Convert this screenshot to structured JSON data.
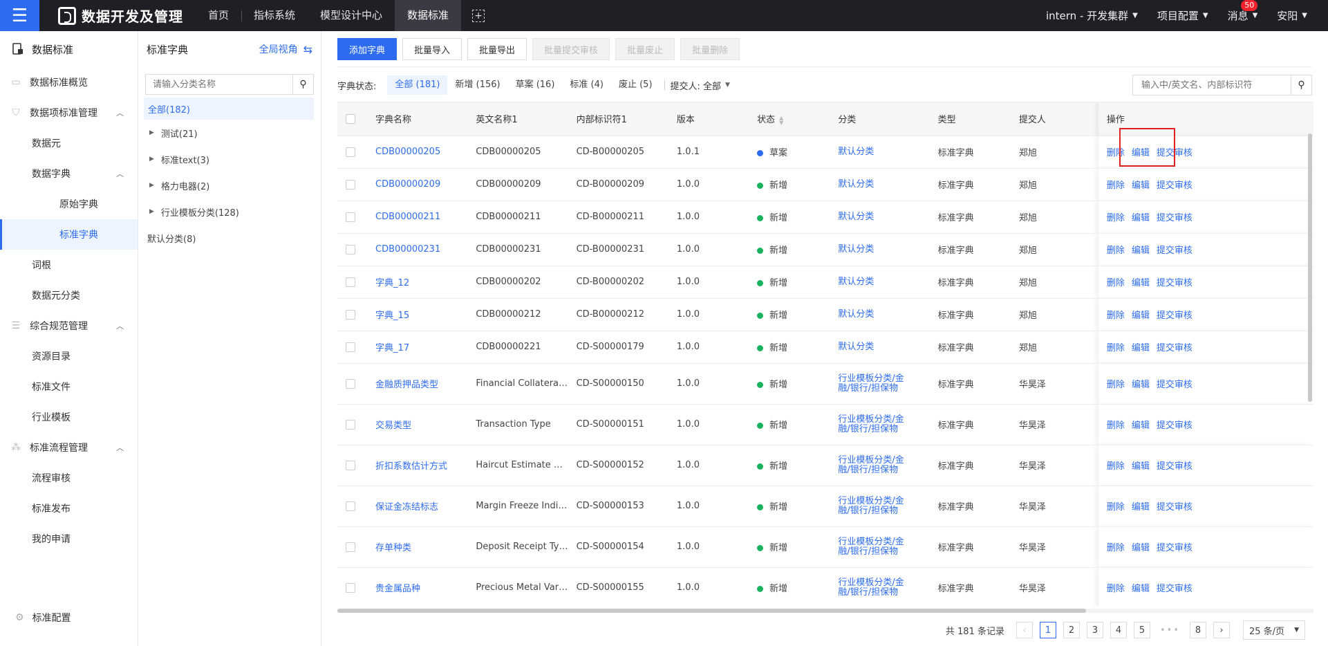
{
  "topbar": {
    "app_title": "数据开发及管理",
    "nav": [
      "首页",
      "指标系统",
      "模型设计中心",
      "数据标准"
    ],
    "cluster": "intern - 开发集群",
    "project": "项目配置",
    "messages": "消息",
    "message_count": "50",
    "user": "安阳"
  },
  "sidebar": {
    "title": "数据标准",
    "items": [
      {
        "label": "数据标准概览"
      },
      {
        "label": "数据项标准管理"
      },
      {
        "label": "数据元"
      },
      {
        "label": "数据字典"
      },
      {
        "label": "原始字典"
      },
      {
        "label": "标准字典"
      },
      {
        "label": "词根"
      },
      {
        "label": "数据元分类"
      },
      {
        "label": "综合规范管理"
      },
      {
        "label": "资源目录"
      },
      {
        "label": "标准文件"
      },
      {
        "label": "行业模板"
      },
      {
        "label": "标准流程管理"
      },
      {
        "label": "流程审核"
      },
      {
        "label": "标准发布"
      },
      {
        "label": "我的申请"
      }
    ],
    "config": "标准配置"
  },
  "tree": {
    "title": "标准字典",
    "view_link": "全局视角",
    "search_placeholder": "请输入分类名称",
    "nodes": [
      "全部(182)",
      "测试(21)",
      "标准text(3)",
      "格力电器(2)",
      "行业模板分类(128)",
      "默认分类(8)"
    ]
  },
  "toolbar": {
    "add": "添加字典",
    "import": "批量导入",
    "export": "批量导出",
    "submit": "批量提交审核",
    "deprecate": "批量废止",
    "delete": "批量删除"
  },
  "filter": {
    "label": "字典状态:",
    "tabs": [
      "全部 (181)",
      "新增 (156)",
      "草案 (16)",
      "标准 (4)",
      "废止 (5)"
    ],
    "submitter": "提交人: 全部",
    "search_placeholder": "输入中/英文名、内部标识符"
  },
  "table": {
    "headers": [
      "字典名称",
      "英文名称1",
      "内部标识符1",
      "版本",
      "状态",
      "分类",
      "类型",
      "提交人",
      "操作"
    ],
    "ops": [
      "删除",
      "编辑",
      "提交审核"
    ],
    "rows": [
      {
        "name": "CDB00000205",
        "en": "CDB00000205",
        "id": "CD-B00000205",
        "ver": "1.0.1",
        "status": "草案",
        "cat": "默认分类",
        "type": "标准字典",
        "submitter": "郑旭"
      },
      {
        "name": "CDB00000209",
        "en": "CDB00000209",
        "id": "CD-B00000209",
        "ver": "1.0.0",
        "status": "新增",
        "cat": "默认分类",
        "type": "标准字典",
        "submitter": "郑旭"
      },
      {
        "name": "CDB00000211",
        "en": "CDB00000211",
        "id": "CD-B00000211",
        "ver": "1.0.0",
        "status": "新增",
        "cat": "默认分类",
        "type": "标准字典",
        "submitter": "郑旭"
      },
      {
        "name": "CDB00000231",
        "en": "CDB00000231",
        "id": "CD-B00000231",
        "ver": "1.0.0",
        "status": "新增",
        "cat": "默认分类",
        "type": "标准字典",
        "submitter": "郑旭"
      },
      {
        "name": "字典_12",
        "en": "CDB00000202",
        "id": "CD-B00000202",
        "ver": "1.0.0",
        "status": "新增",
        "cat": "默认分类",
        "type": "标准字典",
        "submitter": "郑旭"
      },
      {
        "name": "字典_15",
        "en": "CDB00000212",
        "id": "CD-B00000212",
        "ver": "1.0.0",
        "status": "新增",
        "cat": "默认分类",
        "type": "标准字典",
        "submitter": "郑旭"
      },
      {
        "name": "字典_17",
        "en": "CDB00000221",
        "id": "CD-S00000179",
        "ver": "1.0.0",
        "status": "新增",
        "cat": "默认分类",
        "type": "标准字典",
        "submitter": "郑旭"
      },
      {
        "name": "金融质押品类型",
        "en": "Financial Collateral T...",
        "id": "CD-S00000150",
        "ver": "1.0.0",
        "status": "新增",
        "cat": "行业模板分类/金融/银行/担保物",
        "type": "标准字典",
        "submitter": "华昊泽"
      },
      {
        "name": "交易类型",
        "en": "Transaction Type",
        "id": "CD-S00000151",
        "ver": "1.0.0",
        "status": "新增",
        "cat": "行业模板分类/金融/银行/担保物",
        "type": "标准字典",
        "submitter": "华昊泽"
      },
      {
        "name": "折扣系数估计方式",
        "en": "Haircut Estimate Met...",
        "id": "CD-S00000152",
        "ver": "1.0.0",
        "status": "新增",
        "cat": "行业模板分类/金融/银行/担保物",
        "type": "标准字典",
        "submitter": "华昊泽"
      },
      {
        "name": "保证金冻结标志",
        "en": "Margin Freeze Indica...",
        "id": "CD-S00000153",
        "ver": "1.0.0",
        "status": "新增",
        "cat": "行业模板分类/金融/银行/担保物",
        "type": "标准字典",
        "submitter": "华昊泽"
      },
      {
        "name": "存单种类",
        "en": "Deposit Receipt Type",
        "id": "CD-S00000154",
        "ver": "1.0.0",
        "status": "新增",
        "cat": "行业模板分类/金融/银行/担保物",
        "type": "标准字典",
        "submitter": "华昊泽"
      },
      {
        "name": "贵金属品种",
        "en": "Precious Metal Variety",
        "id": "CD-S00000155",
        "ver": "1.0.0",
        "status": "新增",
        "cat": "行业模板分类/金融/银行/担保物",
        "type": "标准字典",
        "submitter": "华昊泽"
      }
    ]
  },
  "status_colors": {
    "草案": "#2d6cf0",
    "新增": "#19b35f"
  },
  "pagination": {
    "total": "共 181 条记录",
    "pages": [
      "1",
      "2",
      "3",
      "4",
      "5",
      "8"
    ],
    "page_size": "25 条/页"
  }
}
